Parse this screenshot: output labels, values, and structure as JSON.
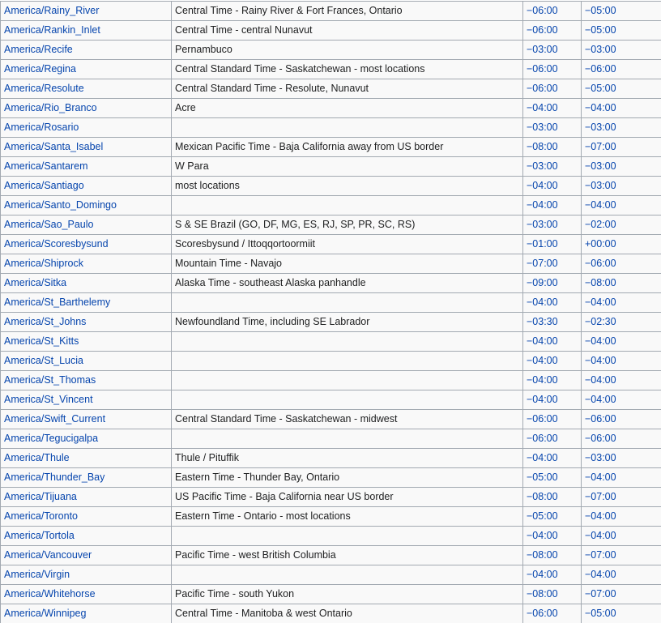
{
  "table": {
    "rows": [
      {
        "zone": "America/Rainy_River",
        "comment": "Central Time - Rainy River & Fort Frances, Ontario",
        "std": "−06:00",
        "dst": "−05:00"
      },
      {
        "zone": "America/Rankin_Inlet",
        "comment": "Central Time - central Nunavut",
        "std": "−06:00",
        "dst": "−05:00"
      },
      {
        "zone": "America/Recife",
        "comment": "Pernambuco",
        "std": "−03:00",
        "dst": "−03:00"
      },
      {
        "zone": "America/Regina",
        "comment": "Central Standard Time - Saskatchewan - most locations",
        "std": "−06:00",
        "dst": "−06:00"
      },
      {
        "zone": "America/Resolute",
        "comment": "Central Standard Time - Resolute, Nunavut",
        "std": "−06:00",
        "dst": "−05:00"
      },
      {
        "zone": "America/Rio_Branco",
        "comment": "Acre",
        "std": "−04:00",
        "dst": "−04:00"
      },
      {
        "zone": "America/Rosario",
        "comment": "",
        "std": "−03:00",
        "dst": "−03:00"
      },
      {
        "zone": "America/Santa_Isabel",
        "comment": "Mexican Pacific Time - Baja California away from US border",
        "std": "−08:00",
        "dst": "−07:00"
      },
      {
        "zone": "America/Santarem",
        "comment": "W Para",
        "std": "−03:00",
        "dst": "−03:00"
      },
      {
        "zone": "America/Santiago",
        "comment": "most locations",
        "std": "−04:00",
        "dst": "−03:00"
      },
      {
        "zone": "America/Santo_Domingo",
        "comment": "",
        "std": "−04:00",
        "dst": "−04:00"
      },
      {
        "zone": "America/Sao_Paulo",
        "comment": "S & SE Brazil (GO, DF, MG, ES, RJ, SP, PR, SC, RS)",
        "std": "−03:00",
        "dst": "−02:00"
      },
      {
        "zone": "America/Scoresbysund",
        "comment": "Scoresbysund / Ittoqqortoormiit",
        "std": "−01:00",
        "dst": "+00:00"
      },
      {
        "zone": "America/Shiprock",
        "comment": "Mountain Time - Navajo",
        "std": "−07:00",
        "dst": "−06:00"
      },
      {
        "zone": "America/Sitka",
        "comment": "Alaska Time - southeast Alaska panhandle",
        "std": "−09:00",
        "dst": "−08:00"
      },
      {
        "zone": "America/St_Barthelemy",
        "comment": "",
        "std": "−04:00",
        "dst": "−04:00"
      },
      {
        "zone": "America/St_Johns",
        "comment": "Newfoundland Time, including SE Labrador",
        "std": "−03:30",
        "dst": "−02:30"
      },
      {
        "zone": "America/St_Kitts",
        "comment": "",
        "std": "−04:00",
        "dst": "−04:00"
      },
      {
        "zone": "America/St_Lucia",
        "comment": "",
        "std": "−04:00",
        "dst": "−04:00"
      },
      {
        "zone": "America/St_Thomas",
        "comment": "",
        "std": "−04:00",
        "dst": "−04:00"
      },
      {
        "zone": "America/St_Vincent",
        "comment": "",
        "std": "−04:00",
        "dst": "−04:00"
      },
      {
        "zone": "America/Swift_Current",
        "comment": "Central Standard Time - Saskatchewan - midwest",
        "std": "−06:00",
        "dst": "−06:00"
      },
      {
        "zone": "America/Tegucigalpa",
        "comment": "",
        "std": "−06:00",
        "dst": "−06:00"
      },
      {
        "zone": "America/Thule",
        "comment": "Thule / Pituffik",
        "std": "−04:00",
        "dst": "−03:00"
      },
      {
        "zone": "America/Thunder_Bay",
        "comment": "Eastern Time - Thunder Bay, Ontario",
        "std": "−05:00",
        "dst": "−04:00"
      },
      {
        "zone": "America/Tijuana",
        "comment": "US Pacific Time - Baja California near US border",
        "std": "−08:00",
        "dst": "−07:00"
      },
      {
        "zone": "America/Toronto",
        "comment": "Eastern Time - Ontario - most locations",
        "std": "−05:00",
        "dst": "−04:00"
      },
      {
        "zone": "America/Tortola",
        "comment": "",
        "std": "−04:00",
        "dst": "−04:00"
      },
      {
        "zone": "America/Vancouver",
        "comment": "Pacific Time - west British Columbia",
        "std": "−08:00",
        "dst": "−07:00"
      },
      {
        "zone": "America/Virgin",
        "comment": "",
        "std": "−04:00",
        "dst": "−04:00"
      },
      {
        "zone": "America/Whitehorse",
        "comment": "Pacific Time - south Yukon",
        "std": "−08:00",
        "dst": "−07:00"
      },
      {
        "zone": "America/Winnipeg",
        "comment": "Central Time - Manitoba & west Ontario",
        "std": "−06:00",
        "dst": "−05:00"
      }
    ]
  }
}
